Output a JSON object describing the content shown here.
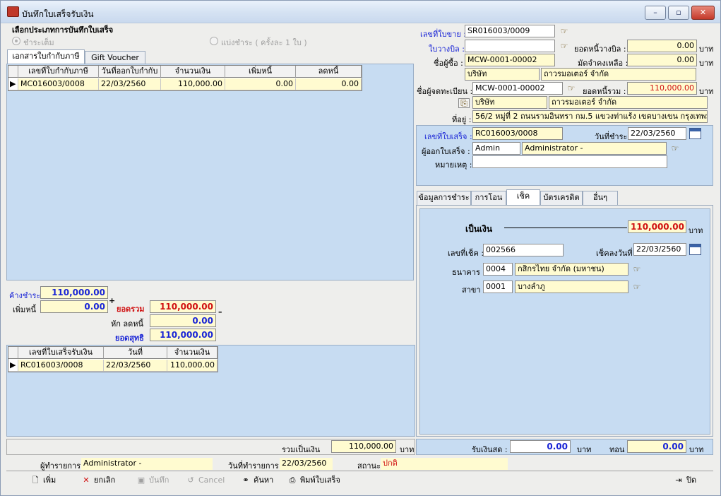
{
  "window": {
    "title": "บันทึกใบเสร็จรับเงิน",
    "min": "–",
    "max": "▫",
    "close": "✕"
  },
  "choice": {
    "heading": "เลือกประเภทการบันทึกใบเสร็จ",
    "opt1": "ชำระเต็ม",
    "opt2": "แบ่งชำระ ( ครั้งละ 1 ใบ )"
  },
  "tabs_left": [
    "เอกสารใบกำกับภาษี",
    "Gift Voucher"
  ],
  "invoice_grid": {
    "headers": [
      "เลขที่ใบกำกับภาษี",
      "วันที่ออกใบกำกับ",
      "จำนวนเงิน",
      "เพิ่มหนี้",
      "ลดหนี้"
    ],
    "row": [
      "MC016003/0008",
      "22/03/2560",
      "110,000.00",
      "0.00",
      "0.00"
    ]
  },
  "summary": {
    "outstanding_label": "ค้างชำระ",
    "outstanding": "110,000.00",
    "plus_label": "เพิ่มหนี้",
    "plus": "0.00",
    "plus_sign": "+",
    "total_label": "ยอดรวม",
    "total": "110,000.00",
    "minus_sign": "–",
    "deduct_label": "หัก ลดหนี้",
    "deduct": "0.00",
    "net_label": "ยอดสุทธิ",
    "net": "110,000.00"
  },
  "receipt_grid": {
    "headers": [
      "เลขที่ใบเสร็จรับเงิน",
      "วันที่",
      "จำนวนเงิน"
    ],
    "row": [
      "RC016003/0008",
      "22/03/2560",
      "110,000.00"
    ]
  },
  "total_cash": {
    "label": "รวมเป็นเงิน",
    "value": "110,000.00",
    "unit": "บาท"
  },
  "right": {
    "sale_no_label": "เลขที่ใบขาย :",
    "sale_no": "SR016003/0009",
    "bill_label": "ใบวางบิล :",
    "bill": "",
    "bill_bal_label": "ยอดหนี้วางบิล :",
    "bill_bal": "0.00",
    "buyer_label": "ชื่อผู้ซื้อ :",
    "buyer_code": "MCW-0001-00002",
    "deposit_label": "มัดจำคงเหลือ :",
    "deposit": "0.00",
    "company_type": "บริษัท",
    "company_name": "ถาวรมอเตอร์ จำกัด",
    "reg_label": "ชื่อผู้จดทะเบียน :",
    "reg_code": "MCW-0001-00002",
    "debt_total_label": "ยอดหนี้รวม :",
    "debt_total": "110,000.00",
    "reg_type": "บริษัท",
    "reg_name": "ถาวรมอเตอร์ จำกัด",
    "addr_label": "ที่อยู่ :",
    "addr": "56/2 หมู่ที่ 2 ถนนรามอินทรา กม.5 แขวงท่าแร้ง เขตบางเขน กรุงเทพมหานคร",
    "unit": "บาท"
  },
  "receipt": {
    "no_label": "เลขที่ใบเสร็จ :",
    "no": "RC016003/0008",
    "date_label": "วันที่ชำระ :",
    "date": "22/03/2560",
    "issuer_label": "ผู้ออกใบเสร็จ :",
    "issuer_code": "Admin",
    "issuer_name": "Administrator -",
    "note_label": "หมายเหตุ :",
    "note": ""
  },
  "pay_tabs": [
    "ข้อมูลการชำระ",
    "การโอน",
    "เช็ค",
    "บัตรเครดิต",
    "อื่นๆ"
  ],
  "cheque": {
    "amount_label": "เป็นเงิน",
    "amount": "110,000.00",
    "unit": "บาท",
    "no_label": "เลขที่เช็ค :",
    "no": "002566",
    "date_label": "เช็คลงวันที่ :",
    "date": "22/03/2560",
    "bank_label": "ธนาคาร :",
    "bank_code": "0004",
    "bank_name": "กสิกรไทย จำกัด (มหาชน)",
    "branch_label": "สาขา :",
    "branch_code": "0001",
    "branch_name": "บางลำภู"
  },
  "cash": {
    "recv_label": "รับเงินสด :",
    "recv": "0.00",
    "unit": "บาท",
    "change_label": "ทอน :",
    "change": "0.00"
  },
  "status": {
    "user_label": "ผู้ทำรายการ :",
    "user": "Administrator -",
    "date_label": "วันที่ทำรายการ :",
    "date": "22/03/2560",
    "state_label": "สถานะ :",
    "state": "ปกติ"
  },
  "toolbar": {
    "add": "เพิ่ม",
    "cancel_doc": "ยกเลิก",
    "save": "บันทึก",
    "cancel": "Cancel",
    "search": "ค้นหา",
    "print": "พิมพ์ใบเสร็จ",
    "close": "ปิด"
  },
  "colors": {
    "title_blue": "#1a25d6",
    "red": "#d01010",
    "panel": "#c7dcf2",
    "yellow": "#fffbd0"
  }
}
